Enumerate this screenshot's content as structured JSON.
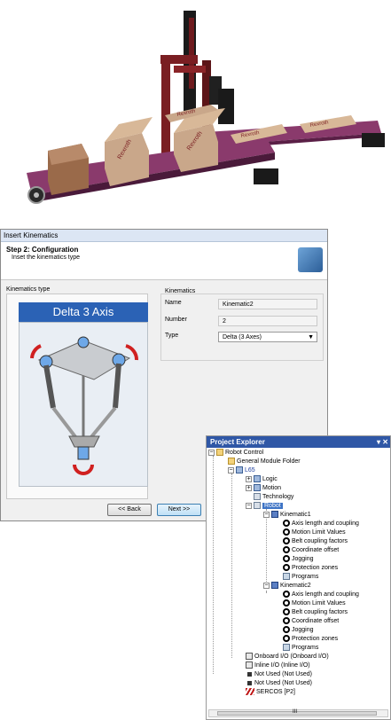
{
  "dialog": {
    "title": "Insert Kinematics",
    "step_title": "Step 2: Configuration",
    "step_subtitle": "Inset the kinematics type",
    "kinematics_type_label": "Kinematics type",
    "banner": "Delta 3 Axis",
    "kinematics_group_label": "Kinematics",
    "fields": [
      {
        "label": "Name",
        "value": "Kinematic2"
      },
      {
        "label": "Number",
        "value": "2"
      },
      {
        "label": "Type",
        "value": "Delta (3 Axes)"
      }
    ],
    "back_label": "<< Back",
    "next_label": "Next >>"
  },
  "explorer": {
    "title": "Project Explorer",
    "controls": "▾ ✕",
    "nodes": {
      "robot_control": "Robot Control",
      "general_module_folder": "General Module Folder",
      "l65": "L65",
      "logic": "Logic",
      "motion": "Motion",
      "technology": "Technology",
      "robot": "Robot",
      "kinematic1": "Kinematic1",
      "kinematic2": "Kinematic2",
      "onboard_io": "Onboard I/O (Onboard I/O)",
      "inline_io": "Inline I/O (Inline I/O)",
      "not_used_1": "Not Used (Not Used)",
      "not_used_2": "Not Used (Not Used)",
      "sercos": "SERCOS [P2]"
    },
    "kin_children": [
      "Axis length and coupling",
      "Motion Limit Values",
      "Belt coupling factors",
      "Coordinate offset",
      "Jogging",
      "Protection zones",
      "Programs"
    ],
    "scroll_label": "III"
  },
  "scene": {
    "box_labels": [
      "Rexroth",
      "Rexroth",
      "Rexroth",
      "Rexroth",
      "Rexroth"
    ]
  },
  "colors": {
    "accent_blue": "#2b62b5",
    "selection": "#3d73c5",
    "conveyor": "#8a3a6c",
    "frame": "#7a1e22"
  }
}
